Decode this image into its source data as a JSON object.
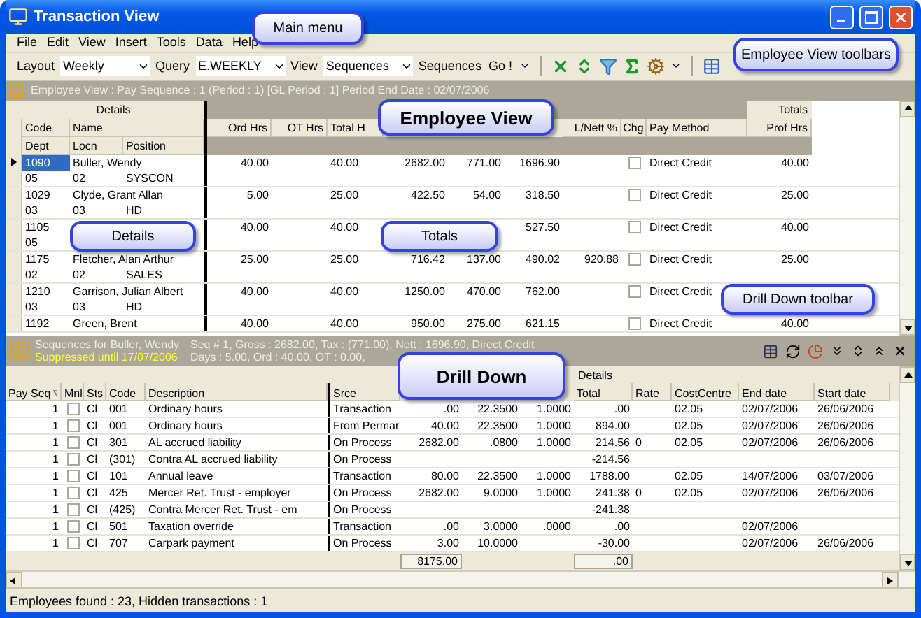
{
  "window": {
    "title": "Transaction View"
  },
  "menu": [
    "File",
    "Edit",
    "View",
    "Insert",
    "Tools",
    "Data",
    "Help"
  ],
  "toolbar": {
    "fields": [
      {
        "label": "Layout",
        "value": "Weekly"
      },
      {
        "label": "Query",
        "value": "E.WEEKLY"
      },
      {
        "label": "View",
        "value": "Sequences"
      }
    ],
    "sequences": "Sequences",
    "go": "Go !"
  },
  "employee_view": {
    "header": "Employee View : Pay Sequence : 1 (Period : 1) [GL Period : 1] Period End Date : 02/07/2006",
    "details_group": "Details",
    "totals_group": "Totals",
    "headers": {
      "code": "Code",
      "name": "Name",
      "dept": "Dept",
      "locn": "Locn",
      "position": "Position",
      "ord_hrs": "Ord Hrs",
      "ot_hrs": "OT Hrs",
      "total_hrs": "Total H",
      "l_nett": "L/Nett %",
      "chg": "Chg",
      "pay_method": "Pay Method",
      "prof_hrs": "Prof Hrs"
    },
    "rows": [
      {
        "code": "1090",
        "name": "Buller, Wendy",
        "dept": "05",
        "locn": "02",
        "position": "SYSCON",
        "selected": true,
        "ord_hrs": "40.00",
        "total_hrs": "40.00",
        "column_4": "2682.00",
        "column_5": "771.00",
        "column_6": "1696.90",
        "chg": false,
        "pay_method": "Direct Credit",
        "prof_hrs": "40.00"
      },
      {
        "code": "1029",
        "name": "Clyde, Grant Allan",
        "dept": "03",
        "locn": "03",
        "position": "HD",
        "selected": false,
        "ord_hrs": "5.00",
        "total_hrs": "25.00",
        "column_4": "422.50",
        "column_5": "54.00",
        "column_6": "318.50",
        "chg": false,
        "pay_method": "Direct Credit",
        "prof_hrs": "25.00"
      },
      {
        "code": "1105",
        "dept": "05",
        "selected": false,
        "ord_hrs": "40.00",
        "total_hrs": "40.00",
        "column_6": "527.50",
        "chg": false,
        "pay_method": "Direct Credit",
        "prof_hrs": "40.00"
      },
      {
        "code": "1175",
        "name": "Fletcher, Alan Arthur",
        "dept": "02",
        "locn": "02",
        "position": "SALES",
        "selected": false,
        "ord_hrs": "25.00",
        "total_hrs": "25.00",
        "column_4": "716.42",
        "column_5": "137.00",
        "column_6": "490.02",
        "l_nett": "920.88",
        "chg": false,
        "pay_method": "Direct Credit",
        "prof_hrs": "25.00"
      },
      {
        "code": "1210",
        "name": "Garrison, Julian Albert",
        "dept": "03",
        "locn": "03",
        "position": "HD",
        "selected": false,
        "ord_hrs": "40.00",
        "total_hrs": "40.00",
        "column_4": "1250.00",
        "column_5": "470.00",
        "column_6": "762.00",
        "chg": false,
        "pay_method": "Direct Credit"
      },
      {
        "code": "1192",
        "name": "Green, Brent",
        "selected": false,
        "ord_hrs": "40.00",
        "total_hrs": "40.00",
        "column_4": "950.00",
        "column_5": "275.00",
        "column_6": "621.15",
        "chg": false,
        "pay_method": "Direct Credit",
        "prof_hrs": "40.00"
      }
    ]
  },
  "drill_down": {
    "title": "Sequences for Buller, Wendy",
    "suppressed": "Suppressed until 17/07/2006",
    "summary": "Seq # 1, Gross : 2682.00, Tax : (771.00), Nett : 1696.90, Direct Credit",
    "days": "Days : 5.00, Ord : 40.00, OT : 0.00,",
    "group": "Details",
    "headers": {
      "pay_seq": "Pay Seq",
      "mnl": "Mnl",
      "sts": "Sts",
      "code": "Code",
      "description": "Description",
      "srce": "Srce",
      "total": "Total",
      "rate": "Rate",
      "cost_centre": "CostCentre",
      "end_date": "End date",
      "start_date": "Start date"
    },
    "rows": [
      {
        "pay_seq": "1",
        "mnl": false,
        "sts": "Cl",
        "code": "001",
        "description": "Ordinary hours",
        "srce": "Transaction",
        "column_7": ".00",
        "column_8": "22.3500",
        "column_9": "1.0000",
        "total": ".00",
        "cost_centre": "02.05",
        "end_date": "02/07/2006",
        "start_date": "26/06/2006"
      },
      {
        "pay_seq": "1",
        "mnl": false,
        "sts": "Cl",
        "code": "001",
        "description": "Ordinary hours",
        "srce": "From Permar",
        "column_7": "40.00",
        "column_8": "22.3500",
        "column_9": "1.0000",
        "total": "894.00",
        "cost_centre": "02.05",
        "end_date": "02/07/2006",
        "start_date": "26/06/2006"
      },
      {
        "pay_seq": "1",
        "mnl": false,
        "sts": "Cl",
        "code": "301",
        "description": "AL accrued liability",
        "srce": "On Process",
        "column_7": "2682.00",
        "column_8": ".0800",
        "column_9": "1.0000",
        "total": "214.56",
        "rate": "0",
        "cost_centre": "02.05",
        "end_date": "02/07/2006",
        "start_date": "26/06/2006"
      },
      {
        "pay_seq": "1",
        "mnl": false,
        "sts": "Cl",
        "code": "(301)",
        "description": "Contra AL accrued liability",
        "srce": "On Process",
        "total": "-214.56"
      },
      {
        "pay_seq": "1",
        "mnl": false,
        "sts": "Cl",
        "code": "101",
        "description": "Annual leave",
        "srce": "Transaction",
        "column_7": "80.00",
        "column_8": "22.3500",
        "column_9": "1.0000",
        "total": "1788.00",
        "cost_centre": "02.05",
        "end_date": "14/07/2006",
        "start_date": "03/07/2006"
      },
      {
        "pay_seq": "1",
        "mnl": false,
        "sts": "Cl",
        "code": "425",
        "description": "Mercer Ret. Trust - employer",
        "srce": "On Process",
        "column_7": "2682.00",
        "column_8": "9.0000",
        "column_9": "1.0000",
        "total": "241.38",
        "rate": "0",
        "cost_centre": "02.05",
        "end_date": "02/07/2006",
        "start_date": "26/06/2006"
      },
      {
        "pay_seq": "1",
        "mnl": false,
        "sts": "Cl",
        "code": "(425)",
        "description": "Contra Mercer Ret. Trust - em",
        "srce": "On Process",
        "total": "-241.38"
      },
      {
        "pay_seq": "1",
        "mnl": false,
        "sts": "Cl",
        "code": "501",
        "description": "Taxation override",
        "srce": "Transaction",
        "column_7": ".00",
        "column_8": "3.0000",
        "column_9": ".0000",
        "total": ".00",
        "end_date": "02/07/2006"
      },
      {
        "pay_seq": "1",
        "mnl": false,
        "sts": "Cl",
        "code": "707",
        "description": "Carpark payment",
        "srce": "On Process",
        "column_7": "3.00",
        "column_8": "10.0000",
        "total": "-30.00",
        "end_date": "02/07/2006",
        "start_date": "26/06/2006"
      }
    ],
    "totals": {
      "quantity": "8175.00",
      "total": ".00"
    }
  },
  "status": "Employees found : 23, Hidden transactions : 1",
  "callouts": [
    {
      "text": "Main menu",
      "kind": "note"
    },
    {
      "text": "Employee View toolbars",
      "kind": "note"
    },
    {
      "text": "Employee View",
      "kind": "heading"
    },
    {
      "text": "Details",
      "kind": "note"
    },
    {
      "text": "Totals",
      "kind": "note"
    },
    {
      "text": "Drill Down toolbar",
      "kind": "note"
    },
    {
      "text": "Drill Down",
      "kind": "heading"
    }
  ]
}
